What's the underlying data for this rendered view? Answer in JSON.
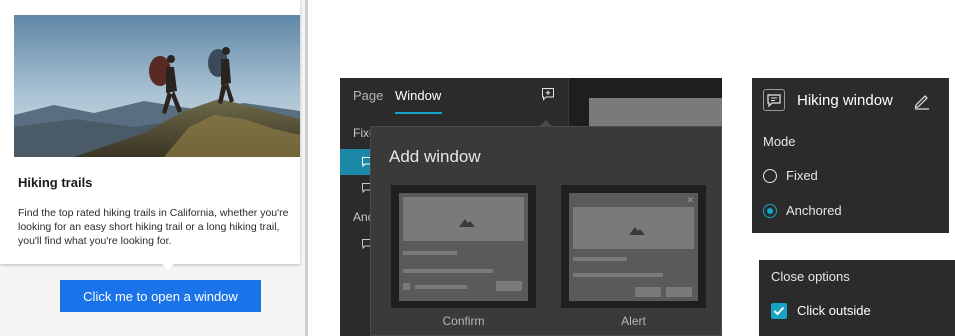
{
  "preview": {
    "popup_title": "Hiking trails",
    "popup_text": "Find the top rated hiking trails in California, whether you're looking for an easy short hiking trail or a long hiking trail, you'll find what you're looking for.",
    "open_button_label": "Click me to open a window"
  },
  "designer": {
    "tabs": [
      "Page",
      "Window"
    ],
    "active_tab": "Window",
    "section_fixed_label": "Fixe",
    "section_anchored_label": "Anc",
    "dialog": {
      "title": "Add window",
      "templates": [
        {
          "label": "Confirm"
        },
        {
          "label": "Alert"
        }
      ]
    }
  },
  "settings": {
    "window_name": "Hiking window",
    "mode_label": "Mode",
    "mode_options": [
      "Fixed",
      "Anchored"
    ],
    "selected_mode": "Anchored"
  },
  "close_options": {
    "title": "Close options",
    "click_outside_label": "Click outside",
    "click_outside_checked": true
  },
  "colors": {
    "accent": "#16a3c4",
    "button_blue": "#1a73e8",
    "dark_panel": "#2b2b2b"
  },
  "icons": {
    "add_window": "add-window-icon",
    "edit": "pencil-edit-icon",
    "window": "window-message-icon"
  }
}
